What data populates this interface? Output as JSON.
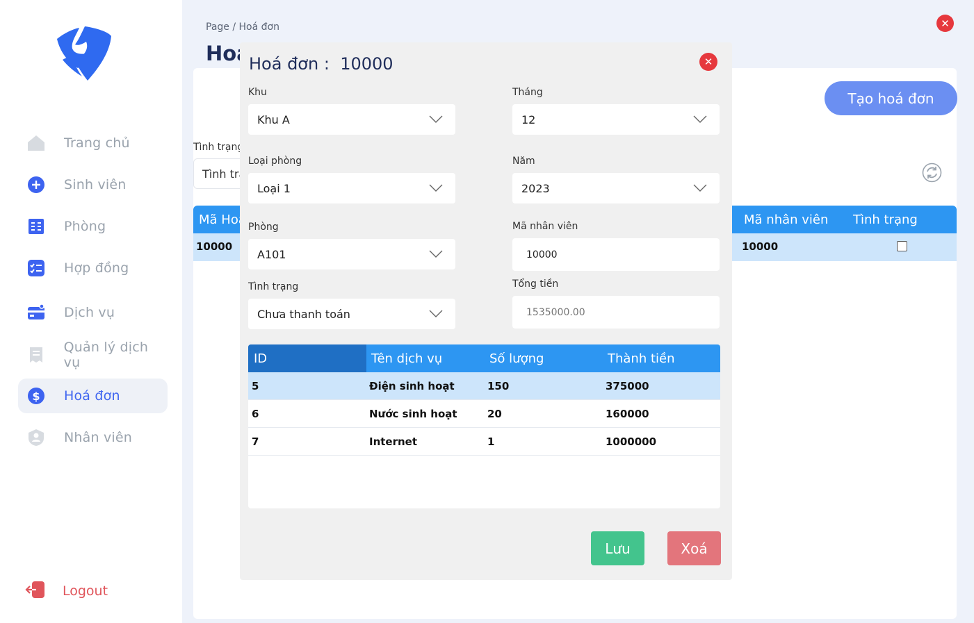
{
  "sidebar": {
    "items": [
      {
        "label": "Trang chủ",
        "icon": "home-icon"
      },
      {
        "label": "Sinh viên",
        "icon": "plus-circle-icon"
      },
      {
        "label": "Phòng",
        "icon": "building-icon"
      },
      {
        "label": "Hợp đồng",
        "icon": "checklist-icon"
      },
      {
        "label": "Dịch vụ",
        "icon": "card-icon"
      },
      {
        "label": "Quản lý dịch vụ",
        "icon": "receipt-icon"
      },
      {
        "label": "Hoá đơn",
        "icon": "dollar-icon"
      },
      {
        "label": "Nhân viên",
        "icon": "user-badge-icon"
      }
    ],
    "active_index": 6,
    "logout_label": "Logout"
  },
  "header": {
    "breadcrumb": "Page / Hoá đơn",
    "title": "Hoá đơn"
  },
  "toolbar": {
    "create_label": "Tạo hoá đơn",
    "filter_label": "Tình trạng",
    "filter_value": "Tình trạng"
  },
  "main_table": {
    "columns": [
      "Mã Hoá đơn",
      "Mã nhân viên",
      "Tình trạng"
    ],
    "rows": [
      {
        "id": "10000",
        "employee": "10000",
        "paid": false
      }
    ]
  },
  "modal": {
    "title_prefix": "Hoá đơn :",
    "invoice_id": "10000",
    "fields": {
      "khu": {
        "label": "Khu",
        "value": "Khu A"
      },
      "thang": {
        "label": "Tháng",
        "value": "12"
      },
      "loai_phong": {
        "label": "Loại phòng",
        "value": "Loại 1"
      },
      "nam": {
        "label": "Năm",
        "value": "2023"
      },
      "phong": {
        "label": "Phòng",
        "value": "A101"
      },
      "ma_nv": {
        "label": "Mã nhân viên",
        "value": "10000"
      },
      "tinh_trang": {
        "label": "Tình trạng",
        "value": "Chưa thanh toán"
      },
      "tong_tien": {
        "label": "Tổng tiền",
        "value": "1535000.00"
      }
    },
    "services": {
      "columns": [
        "ID",
        "Tên dịch vụ",
        "Số lượng",
        "Thành tiền"
      ],
      "rows": [
        {
          "id": "5",
          "name": "Điện sinh hoạt",
          "qty": "150",
          "amount": "375000"
        },
        {
          "id": "6",
          "name": "Nước sinh hoạt",
          "qty": "20",
          "amount": "160000"
        },
        {
          "id": "7",
          "name": "Internet",
          "qty": "1",
          "amount": "1000000"
        }
      ]
    },
    "save_label": "Lưu",
    "delete_label": "Xoá"
  },
  "colors": {
    "accent": "#4066f0",
    "table_header": "#2d96f2",
    "close": "#e6383d",
    "save": "#43c48d",
    "delete": "#e3757c"
  }
}
